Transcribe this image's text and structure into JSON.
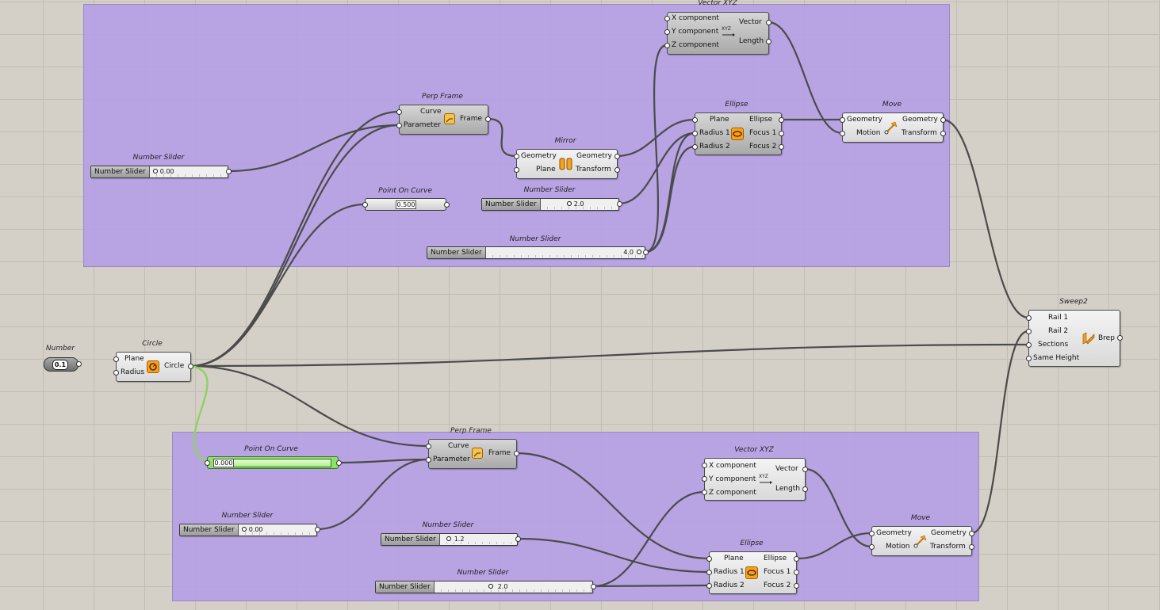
{
  "colors": {
    "group": "#b6a0e6",
    "wire": "#4b4b4b",
    "wire_selected": "#8dd35f",
    "icon": "#f7a21b"
  },
  "components": {
    "vector_top": {
      "title": "Vector XYZ",
      "in": [
        "X component",
        "Y component",
        "Z component"
      ],
      "out": [
        "Vector",
        "Length"
      ],
      "icon": "vector-xyz-icon"
    },
    "perp_top": {
      "title": "Perp Frame",
      "in": [
        "Curve",
        "Parameter"
      ],
      "out": [
        "Frame"
      ],
      "icon": "perp-frame-icon"
    },
    "mirror": {
      "title": "Mirror",
      "in": [
        "Geometry",
        "Plane"
      ],
      "out": [
        "Geometry",
        "Transform"
      ],
      "icon": "mirror-icon"
    },
    "ellipse_top": {
      "title": "Ellipse",
      "in": [
        "Plane",
        "Radius 1",
        "Radius 2"
      ],
      "out": [
        "Ellipse",
        "Focus 1",
        "Focus 2"
      ],
      "icon": "ellipse-icon"
    },
    "move_top": {
      "title": "Move",
      "in": [
        "Geometry",
        "Motion"
      ],
      "out": [
        "Geometry",
        "Transform"
      ],
      "icon": "move-icon"
    },
    "sweep2": {
      "title": "Sweep2",
      "in": [
        "Rail 1",
        "Rail 2",
        "Sections",
        "Same Height"
      ],
      "out": [
        "Brep"
      ],
      "icon": "sweep2-icon"
    },
    "circle": {
      "title": "Circle",
      "in": [
        "Plane",
        "Radius"
      ],
      "out": [
        "Circle"
      ],
      "icon": "circle-icon"
    },
    "perp_bot": {
      "title": "Perp Frame",
      "in": [
        "Curve",
        "Parameter"
      ],
      "out": [
        "Frame"
      ],
      "icon": "perp-frame-icon"
    },
    "vector_bot": {
      "title": "Vector XYZ",
      "in": [
        "X component",
        "Y component",
        "Z component"
      ],
      "out": [
        "Vector",
        "Length"
      ],
      "icon": "vector-xyz-icon"
    },
    "ellipse_bot": {
      "title": "Ellipse",
      "in": [
        "Plane",
        "Radius 1",
        "Radius 2"
      ],
      "out": [
        "Ellipse",
        "Focus 1",
        "Focus 2"
      ],
      "icon": "ellipse-icon"
    },
    "move_bot": {
      "title": "Move",
      "in": [
        "Geometry",
        "Motion"
      ],
      "out": [
        "Geometry",
        "Transform"
      ],
      "icon": "move-icon"
    }
  },
  "sliders": {
    "s_top_a": {
      "title": "Number Slider",
      "name": "Number Slider",
      "value": "0.00",
      "fraction": 0.0
    },
    "s_top_b": {
      "title": "Number Slider",
      "name": "Number Slider",
      "value": "2.0",
      "fraction": 0.35
    },
    "s_top_c": {
      "title": "Number Slider",
      "name": "Number Slider",
      "value": "4.0",
      "fraction": 1.0
    },
    "s_bot_a": {
      "title": "Number Slider",
      "name": "Number Slider",
      "value": "0.00",
      "fraction": 0.0
    },
    "s_bot_b": {
      "title": "Number Slider",
      "name": "Number Slider",
      "value": "1.2",
      "fraction": 0.05
    },
    "s_bot_c": {
      "title": "Number Slider",
      "name": "Number Slider",
      "value": "2.0",
      "fraction": 0.35
    }
  },
  "point_on_curve": {
    "top": {
      "title": "Point On Curve",
      "value": "0.500"
    },
    "bot": {
      "title": "Point On Curve",
      "value": "0.000"
    }
  },
  "number": {
    "title": "Number",
    "value": "0.1"
  }
}
